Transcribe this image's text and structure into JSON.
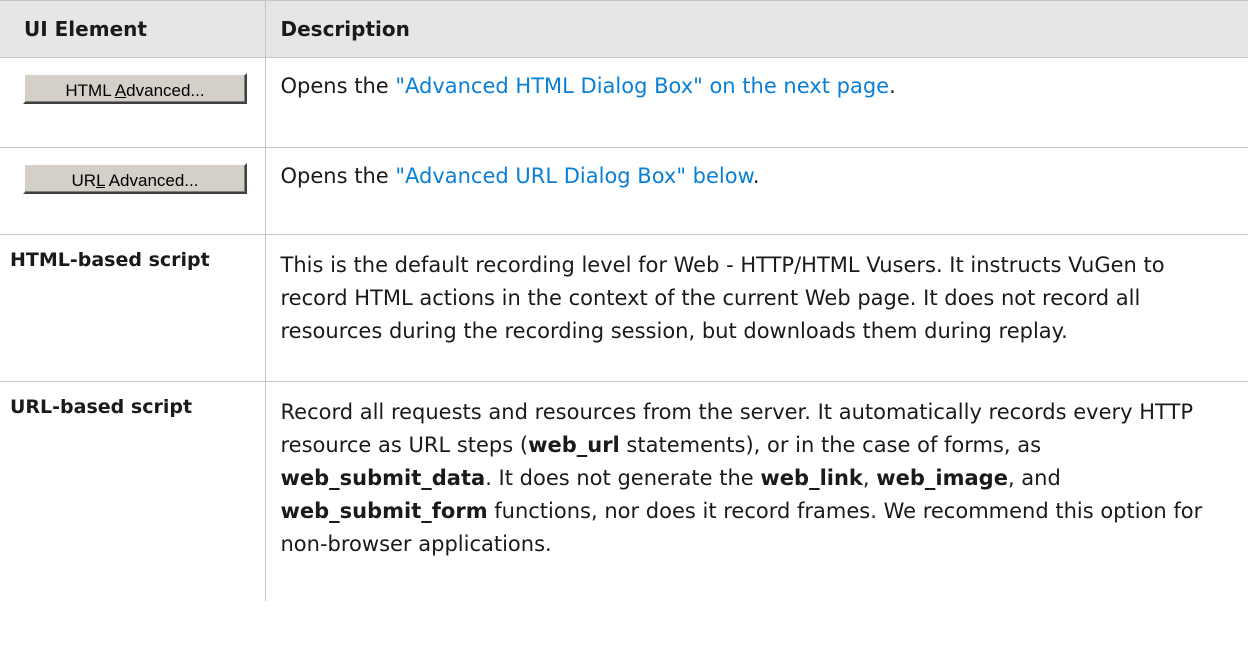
{
  "table": {
    "headers": {
      "element": "UI Element",
      "description": "Description"
    },
    "rows": {
      "html_advanced": {
        "button": {
          "pre": "HTML ",
          "mnemonic": "A",
          "post": "dvanced..."
        },
        "desc_before": "Opens the ",
        "link": "\"Advanced HTML Dialog Box\" on the next page",
        "desc_after": "."
      },
      "url_advanced": {
        "button": {
          "pre": "UR",
          "mnemonic": "L",
          "post": " Advanced..."
        },
        "desc_before": "Opens the ",
        "link": "\"Advanced URL Dialog Box\" below",
        "desc_after": "."
      },
      "html_based": {
        "element": "HTML-based script",
        "description": "This is the default recording level for Web - HTTP/HTML Vusers. It instructs VuGen to record HTML actions in the context of the current Web page. It does not record all resources during the recording session, but downloads them during replay."
      },
      "url_based": {
        "element": "URL-based script",
        "d1": "Record all requests and resources from the server. It automatically records every HTTP resource as URL steps (",
        "b1": "web_url",
        "d2": " statements), or in the case of forms, as ",
        "b2": "web_submit_data",
        "d3": ". It does not generate the ",
        "b3": "web_link",
        "d4": ", ",
        "b4": "web_image",
        "d5": ", and ",
        "b5": "web_submit_form",
        "d6": " functions, nor does it record frames. We recommend this option for non-browser applications."
      }
    }
  },
  "colors": {
    "link": "#0a7fd6",
    "header_bg": "#e6e6e6",
    "border": "#c6c6c6",
    "button_face": "#d4d0c8"
  }
}
